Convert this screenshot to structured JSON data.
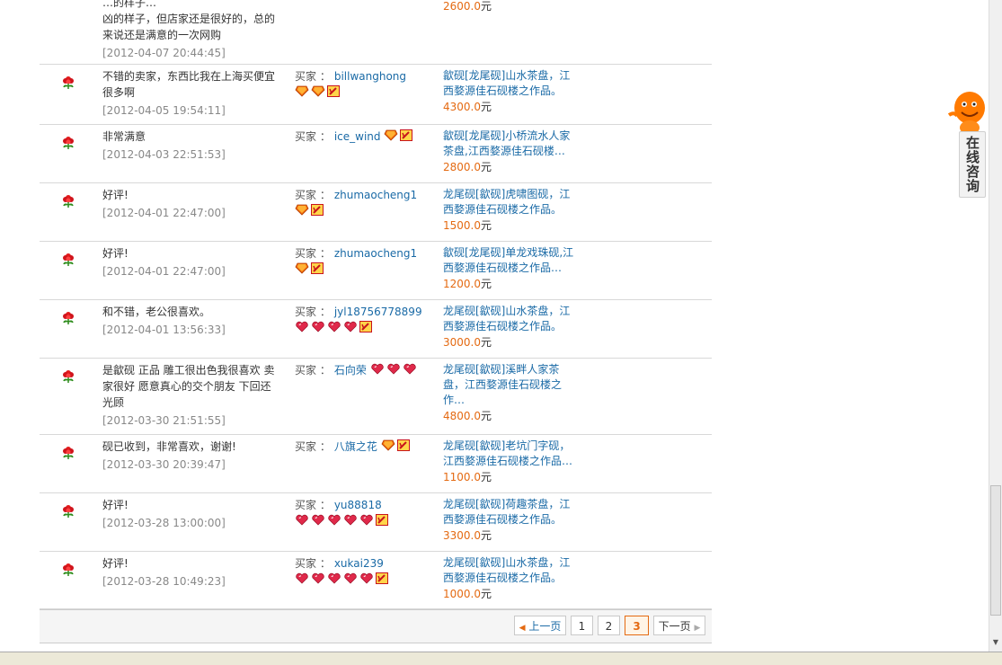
{
  "reviews": [
    {
      "comment_lines": [
        "…的样子…",
        "凶的样子，但店家还是很好的，总的",
        "来说还是满意的一次网购"
      ],
      "date": "[2012-04-07 20:44:45]",
      "buyer_label": "",
      "buyer": "",
      "product_title": "",
      "price": "2600.0",
      "unit": "元",
      "badges": []
    },
    {
      "comment_lines": [
        "不错的卖家，东西比我在上海买便宜",
        "很多啊"
      ],
      "date": "[2012-04-05 19:54:11]",
      "buyer_label": "买家 ：",
      "buyer": "billwanghong",
      "product_title": "歙砚[龙尾砚]山水茶盘，江西婺源佳石砚楼之作品。",
      "price": "4300.0",
      "unit": "元",
      "badges": [
        "diamond",
        "diamond",
        "vip"
      ]
    },
    {
      "comment_lines": [
        "非常满意"
      ],
      "date": "[2012-04-03 22:51:53]",
      "buyer_label": "买家 ：",
      "buyer": "ice_wind",
      "product_title": "歙砚[龙尾砚]小桥流水人家茶盘,江西婺源佳石砚楼…",
      "price": "2800.0",
      "unit": "元",
      "badges": [
        "diamond",
        "vip"
      ]
    },
    {
      "comment_lines": [
        "好评!"
      ],
      "date": "[2012-04-01 22:47:00]",
      "buyer_label": "买家 ：",
      "buyer": "zhumaocheng1",
      "product_title": "龙尾砚[歙砚]虎啸图砚，江西婺源佳石砚楼之作品。",
      "price": "1500.0",
      "unit": "元",
      "badges": [
        "diamond",
        "vip"
      ]
    },
    {
      "comment_lines": [
        "好评!"
      ],
      "date": "[2012-04-01 22:47:00]",
      "buyer_label": "买家 ：",
      "buyer": "zhumaocheng1",
      "product_title": "歙砚[龙尾砚]单龙戏珠砚,江西婺源佳石砚楼之作品…",
      "price": "1200.0",
      "unit": "元",
      "badges": [
        "diamond",
        "vip"
      ]
    },
    {
      "comment_lines": [
        "和不错，老公很喜欢。"
      ],
      "date": "[2012-04-01 13:56:33]",
      "buyer_label": "买家 ：",
      "buyer": "jyl18756778899",
      "product_title": "龙尾砚[歙砚]山水茶盘，江西婺源佳石砚楼之作品。",
      "price": "3000.0",
      "unit": "元",
      "badges": [
        "heart",
        "heart",
        "heart",
        "heart",
        "vip"
      ]
    },
    {
      "comment_lines": [
        "是歙砚 正品 雕工很出色我很喜欢 卖",
        "家很好 愿意真心的交个朋友 下回还",
        "光顾"
      ],
      "date": "[2012-03-30 21:51:55]",
      "buyer_label": "买家 ：",
      "buyer": "石向荣",
      "product_title": "龙尾砚[歙砚]溪畔人家茶盘，江西婺源佳石砚楼之作…",
      "price": "4800.0",
      "unit": "元",
      "badges": [
        "heart",
        "heart",
        "heart"
      ]
    },
    {
      "comment_lines": [
        "砚已收到，非常喜欢，谢谢!"
      ],
      "date": "[2012-03-30 20:39:47]",
      "buyer_label": "买家 ：",
      "buyer": "八旗之花",
      "product_title": "龙尾砚[歙砚]老坑门字砚，江西婺源佳石砚楼之作品…",
      "price": "1100.0",
      "unit": "元",
      "badges": [
        "diamond",
        "vip"
      ]
    },
    {
      "comment_lines": [
        "好评!"
      ],
      "date": "[2012-03-28 13:00:00]",
      "buyer_label": "买家 ：",
      "buyer": "yu88818",
      "product_title": "龙尾砚[歙砚]荷趣茶盘，江西婺源佳石砚楼之作品。",
      "price": "3300.0",
      "unit": "元",
      "badges": [
        "heart",
        "heart",
        "heart",
        "heart",
        "heart",
        "vip"
      ]
    },
    {
      "comment_lines": [
        "好评!"
      ],
      "date": "[2012-03-28 10:49:23]",
      "buyer_label": "买家 ：",
      "buyer": "xukai239",
      "product_title": "龙尾砚[歙砚]山水茶盘，江西婺源佳石砚楼之作品。",
      "price": "1000.0",
      "unit": "元",
      "badges": [
        "heart",
        "heart",
        "heart",
        "heart",
        "heart",
        "vip"
      ]
    }
  ],
  "pagination": {
    "prev": "上一页",
    "pages": [
      "1",
      "2",
      "3"
    ],
    "current": "3",
    "next": "下一页"
  },
  "consult": {
    "label": "在线咨询"
  },
  "colors": {
    "link": "#1a6aa6",
    "price": "#e46a12",
    "border": "#d8d8d8"
  }
}
